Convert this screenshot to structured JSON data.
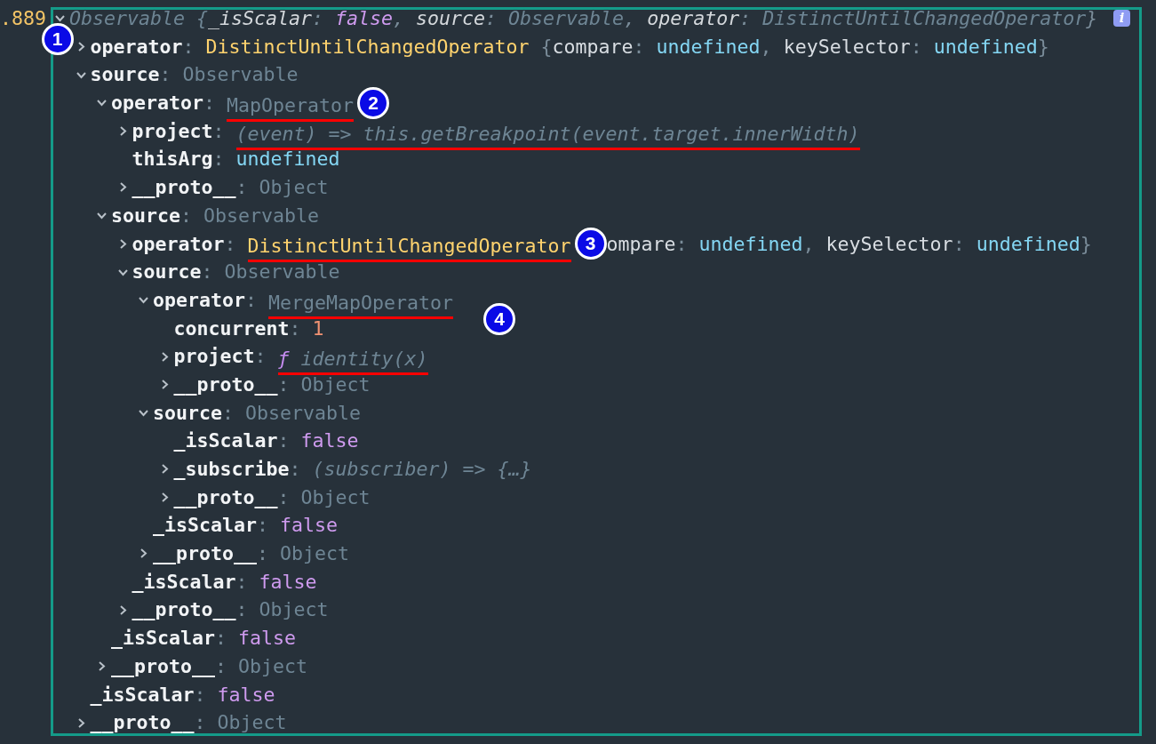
{
  "gutter_label": ".889",
  "info_badge": "i",
  "tree": [
    {
      "key": "Observable {",
      "kind": "summary",
      "expanded": true,
      "value": [
        {
          "text": "_isScalar",
          "kind": "preview-key"
        },
        {
          "text": ": ",
          "kind": "punct"
        },
        {
          "text": "false",
          "kind": "boolean"
        },
        {
          "text": ", ",
          "kind": "punct"
        },
        {
          "text": "source",
          "kind": "preview-key"
        },
        {
          "text": ": ",
          "kind": "punct"
        },
        {
          "text": "Observable",
          "kind": "type"
        },
        {
          "text": ", ",
          "kind": "punct"
        },
        {
          "text": "operator",
          "kind": "preview-key"
        },
        {
          "text": ": ",
          "kind": "punct"
        },
        {
          "text": "DistinctUntilChangedOperator",
          "kind": "type"
        },
        {
          "text": "}",
          "kind": "punct"
        }
      ],
      "children": [
        {
          "key": "operator",
          "expanded": false,
          "badge": {
            "label": "1",
            "kind": "left"
          },
          "value": [
            {
              "text": ": ",
              "kind": "punct"
            },
            {
              "text": "DistinctUntilChangedOperator",
              "kind": "class"
            },
            {
              "text": " {",
              "kind": "punct"
            },
            {
              "text": "compare",
              "kind": "prop"
            },
            {
              "text": ": ",
              "kind": "punct"
            },
            {
              "text": "undefined",
              "kind": "undefined"
            },
            {
              "text": ", ",
              "kind": "punct"
            },
            {
              "text": "keySelector",
              "kind": "prop"
            },
            {
              "text": ": ",
              "kind": "punct"
            },
            {
              "text": "undefined",
              "kind": "undefined"
            },
            {
              "text": "}",
              "kind": "punct"
            }
          ]
        },
        {
          "key": "source",
          "expanded": true,
          "value": [
            {
              "text": ": ",
              "kind": "punct"
            },
            {
              "text": "Observable",
              "kind": "type"
            }
          ],
          "children": [
            {
              "key": "operator",
              "expanded": true,
              "value": [
                {
                  "text": ": ",
                  "kind": "punct"
                },
                {
                  "text": "MapOperator",
                  "kind": "type",
                  "underlined": true
                },
                {
                  "text": "2",
                  "kind": "marker"
                }
              ],
              "children": [
                {
                  "key": "project",
                  "expanded": false,
                  "value": [
                    {
                      "text": ": ",
                      "kind": "punct"
                    },
                    {
                      "text": "(event) => this.getBreakpoint(event.target.innerWidth)",
                      "kind": "function",
                      "underlined": true
                    }
                  ]
                },
                {
                  "key": "thisArg",
                  "value": [
                    {
                      "text": ": ",
                      "kind": "punct"
                    },
                    {
                      "text": "undefined",
                      "kind": "undefined"
                    }
                  ]
                },
                {
                  "key": "__proto__",
                  "expanded": false,
                  "value": [
                    {
                      "text": ": ",
                      "kind": "punct"
                    },
                    {
                      "text": "Object",
                      "kind": "type"
                    }
                  ]
                }
              ]
            },
            {
              "key": "source",
              "expanded": true,
              "value": [
                {
                  "text": ": ",
                  "kind": "punct"
                },
                {
                  "text": "Observable",
                  "kind": "type"
                }
              ],
              "children": [
                {
                  "key": "operator",
                  "expanded": false,
                  "value": [
                    {
                      "text": ": ",
                      "kind": "punct"
                    },
                    {
                      "text": "DistinctUntilChangedOperator",
                      "kind": "class",
                      "underlined": true
                    },
                    {
                      "text": "3",
                      "kind": "marker"
                    },
                    {
                      "text": "ompare",
                      "kind": "prop"
                    },
                    {
                      "text": ": ",
                      "kind": "punct"
                    },
                    {
                      "text": "undefined",
                      "kind": "undefined"
                    },
                    {
                      "text": ", ",
                      "kind": "punct"
                    },
                    {
                      "text": "keySelector",
                      "kind": "prop"
                    },
                    {
                      "text": ": ",
                      "kind": "punct"
                    },
                    {
                      "text": "undefined",
                      "kind": "undefined"
                    },
                    {
                      "text": "}",
                      "kind": "punct"
                    }
                  ]
                },
                {
                  "key": "source",
                  "expanded": true,
                  "value": [
                    {
                      "text": ": ",
                      "kind": "punct"
                    },
                    {
                      "text": "Observable",
                      "kind": "type"
                    }
                  ],
                  "children": [
                    {
                      "key": "operator",
                      "expanded": true,
                      "badge": {
                        "label": "4",
                        "kind": "below"
                      },
                      "value": [
                        {
                          "text": ": ",
                          "kind": "punct"
                        },
                        {
                          "text": "MergeMapOperator",
                          "kind": "type",
                          "underlined": true
                        }
                      ],
                      "children": [
                        {
                          "key": "concurrent",
                          "value": [
                            {
                              "text": ": ",
                              "kind": "punct"
                            },
                            {
                              "text": "1",
                              "kind": "number"
                            }
                          ]
                        },
                        {
                          "key": "project",
                          "expanded": false,
                          "value": [
                            {
                              "text": ": ",
                              "kind": "punct"
                            },
                            {
                              "text": "ƒ",
                              "kind": "f-sign",
                              "underlined": true
                            },
                            {
                              "text": " identity(x)",
                              "kind": "function",
                              "underlined": true
                            }
                          ]
                        },
                        {
                          "key": "__proto__",
                          "expanded": false,
                          "value": [
                            {
                              "text": ": ",
                              "kind": "punct"
                            },
                            {
                              "text": "Object",
                              "kind": "type"
                            }
                          ]
                        }
                      ]
                    },
                    {
                      "key": "source",
                      "expanded": true,
                      "value": [
                        {
                          "text": ": ",
                          "kind": "punct"
                        },
                        {
                          "text": "Observable",
                          "kind": "type"
                        }
                      ],
                      "children": [
                        {
                          "key": "_isScalar",
                          "value": [
                            {
                              "text": ": ",
                              "kind": "punct"
                            },
                            {
                              "text": "false",
                              "kind": "boolean"
                            }
                          ]
                        },
                        {
                          "key": "_subscribe",
                          "expanded": false,
                          "value": [
                            {
                              "text": ": ",
                              "kind": "punct"
                            },
                            {
                              "text": "(subscriber) => {…}",
                              "kind": "function"
                            }
                          ]
                        },
                        {
                          "key": "__proto__",
                          "expanded": false,
                          "value": [
                            {
                              "text": ": ",
                              "kind": "punct"
                            },
                            {
                              "text": "Object",
                              "kind": "type"
                            }
                          ]
                        }
                      ]
                    },
                    {
                      "key": "_isScalar",
                      "value": [
                        {
                          "text": ": ",
                          "kind": "punct"
                        },
                        {
                          "text": "false",
                          "kind": "boolean"
                        }
                      ]
                    },
                    {
                      "key": "__proto__",
                      "expanded": false,
                      "value": [
                        {
                          "text": ": ",
                          "kind": "punct"
                        },
                        {
                          "text": "Object",
                          "kind": "type"
                        }
                      ]
                    }
                  ]
                },
                {
                  "key": "_isScalar",
                  "value": [
                    {
                      "text": ": ",
                      "kind": "punct"
                    },
                    {
                      "text": "false",
                      "kind": "boolean"
                    }
                  ]
                },
                {
                  "key": "__proto__",
                  "expanded": false,
                  "value": [
                    {
                      "text": ": ",
                      "kind": "punct"
                    },
                    {
                      "text": "Object",
                      "kind": "type"
                    }
                  ]
                }
              ]
            },
            {
              "key": "_isScalar",
              "value": [
                {
                  "text": ": ",
                  "kind": "punct"
                },
                {
                  "text": "false",
                  "kind": "boolean"
                }
              ]
            },
            {
              "key": "__proto__",
              "expanded": false,
              "value": [
                {
                  "text": ": ",
                  "kind": "punct"
                },
                {
                  "text": "Object",
                  "kind": "type"
                }
              ]
            }
          ]
        },
        {
          "key": "_isScalar",
          "value": [
            {
              "text": ": ",
              "kind": "punct"
            },
            {
              "text": "false",
              "kind": "boolean"
            }
          ]
        },
        {
          "key": "__proto__",
          "expanded": false,
          "value": [
            {
              "text": ": ",
              "kind": "punct"
            },
            {
              "text": "Object",
              "kind": "type"
            }
          ]
        }
      ]
    }
  ]
}
